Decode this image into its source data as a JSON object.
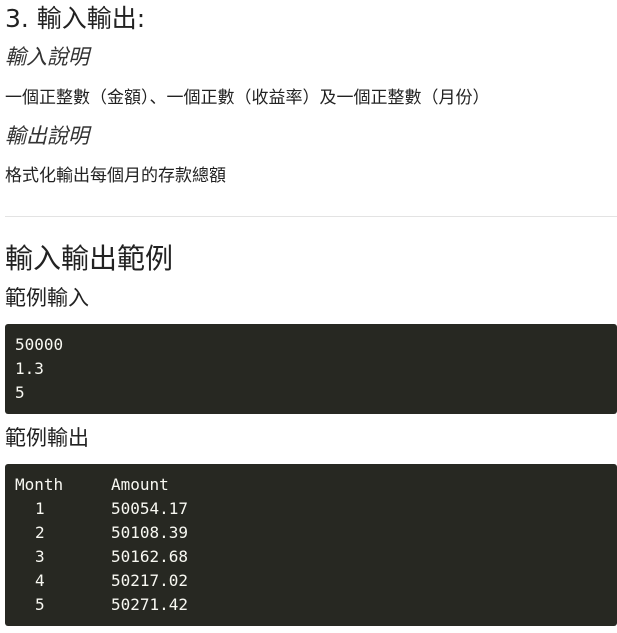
{
  "section": {
    "title": "3. 輸入輸出:"
  },
  "input_desc": {
    "heading": "輸入說明",
    "text": "一個正整數（金額）、一個正數（收益率）及一個正整數（月份）"
  },
  "output_desc": {
    "heading": "輸出說明",
    "text": "格式化輸出每個月的存款總額"
  },
  "examples": {
    "heading": "輸入輸出範例",
    "sample_input": {
      "heading": "範例輸入",
      "lines": [
        "50000",
        "1.3",
        "5"
      ]
    },
    "sample_output": {
      "heading": "範例輸出",
      "header": {
        "month": "Month",
        "amount": "Amount"
      },
      "rows": [
        {
          "month": "1",
          "amount": "50054.17"
        },
        {
          "month": "2",
          "amount": "50108.39"
        },
        {
          "month": "3",
          "amount": "50162.68"
        },
        {
          "month": "4",
          "amount": "50217.02"
        },
        {
          "month": "5",
          "amount": "50271.42"
        }
      ]
    }
  },
  "colors": {
    "code_background": "#272822",
    "code_text": "#f8f8f2",
    "body_text": "#222222",
    "divider": "#e3e3e3"
  }
}
